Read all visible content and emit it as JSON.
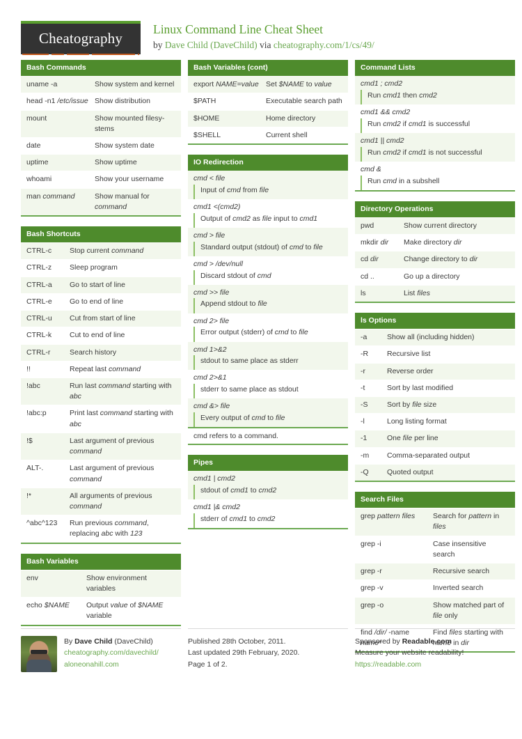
{
  "header": {
    "logo_text": "Cheatography",
    "title": "Linux Command Line Cheat Sheet",
    "byline_prefix": "by ",
    "author": "Dave Child (DaveChild)",
    "byline_via": " via ",
    "url": "cheatography.com/1/cs/49/"
  },
  "colors": {
    "brand_green": "#4e8b2c",
    "accent_green": "#6aa84f",
    "row_tint": "#f2f7ec",
    "logo_dark": "#333333",
    "logo_orange": "#c1571a"
  },
  "blocks": {
    "bash_commands": {
      "title": "Bash Commands",
      "rows": [
        {
          "k": "uname -a",
          "k_green": true,
          "v": "Show system and kernel"
        },
        {
          "k": "head -n1 /etc/issue",
          "k_green": true,
          "v": "Show distribution"
        },
        {
          "k": "mount",
          "k_green": true,
          "v": "Show mounted filesy­stems"
        },
        {
          "k": "date",
          "k_green": true,
          "v": "Show system date"
        },
        {
          "k": "uptime",
          "k_green": true,
          "v": "Show uptime"
        },
        {
          "k": "whoami",
          "k_green": true,
          "v": "Show your username"
        },
        {
          "k": "man command",
          "k_green": true,
          "v": "Show manual for command"
        }
      ]
    },
    "bash_shortcuts": {
      "title": "Bash Shortcuts",
      "rows": [
        {
          "k": "CTRL-c",
          "v": "Stop current command"
        },
        {
          "k": "CTRL-z",
          "v": "Sleep program"
        },
        {
          "k": "CTRL-a",
          "v": "Go to start of line"
        },
        {
          "k": "CTRL-e",
          "v": "Go to end of line"
        },
        {
          "k": "CTRL-u",
          "v": "Cut from start of line"
        },
        {
          "k": "CTRL-k",
          "v": "Cut to end of line"
        },
        {
          "k": "CTRL-r",
          "v": "Search history"
        },
        {
          "k": "!!",
          "v": "Repeat last command"
        },
        {
          "k": "!abc",
          "v": "Run last command starting with abc"
        },
        {
          "k": "!abc:p",
          "v": "Print last command starting with abc"
        },
        {
          "k": "!$",
          "v": "Last argument of previous command"
        },
        {
          "k": "ALT-.",
          "v": "Last argument of previous command"
        },
        {
          "k": "!*",
          "v": "All arguments of previous command"
        },
        {
          "k": "^abc^123",
          "v": "Run previous command, replacing abc with 123"
        }
      ]
    },
    "bash_variables": {
      "title": "Bash Variables",
      "rows": [
        {
          "k": "env",
          "v": "Show environment variables"
        },
        {
          "k": "echo $NAME",
          "k_green": true,
          "v": "Output value of $NAME variable"
        }
      ]
    },
    "bash_variables_cont": {
      "title": "Bash Variables (cont)",
      "rows": [
        {
          "k": "export NAME=value",
          "k_green": true,
          "v": "Set $NAME to value"
        },
        {
          "k": "$PATH",
          "v": "Executable search path"
        },
        {
          "k": "$HOME",
          "v": "Home directory"
        },
        {
          "k": "$SHELL",
          "v": "Current shell"
        }
      ]
    },
    "io_redirection": {
      "title": "IO Redirection",
      "rows": [
        {
          "code": "cmd < file",
          "desc": "Input of cmd from file"
        },
        {
          "code": "cmd1 <(cmd2)",
          "desc": "Output of cmd2 as file input to cmd1"
        },
        {
          "code": "cmd > file",
          "desc": "Standard output (stdout) of cmd to file"
        },
        {
          "code": "cmd > /dev/null",
          "desc": "Discard stdout of cmd"
        },
        {
          "code": "cmd >> file",
          "desc": "Append stdout to file"
        },
        {
          "code": "cmd 2> file",
          "desc": "Error output (stderr) of cmd to file"
        },
        {
          "code": "cmd 1>&2",
          "desc": "stdout to same place as stderr"
        },
        {
          "code": "cmd 2>&1",
          "desc": "stderr to same place as stdout"
        },
        {
          "code": "cmd &> file",
          "desc": "Every output of cmd to file"
        }
      ],
      "note": "cmd refers to a command."
    },
    "pipes": {
      "title": "Pipes",
      "rows": [
        {
          "code": "cmd1 | cmd2",
          "desc": "stdout of cmd1 to cmd2"
        },
        {
          "code": "cmd1 |& cmd2",
          "desc": "stderr of cmd1 to cmd2"
        }
      ]
    },
    "command_lists": {
      "title": "Command Lists",
      "rows": [
        {
          "code": "cmd1 ; cmd2",
          "desc": "Run cmd1 then cmd2"
        },
        {
          "code": "cmd1 && cmd2",
          "desc": "Run cmd2 if cmd1 is successful"
        },
        {
          "code": "cmd1 || cmd2",
          "desc": "Run cmd2 if cmd1 is not successful"
        },
        {
          "code": "cmd &",
          "desc": "Run cmd in a subshell"
        }
      ]
    },
    "directory_operations": {
      "title": "Directory Operations",
      "rows": [
        {
          "k": "pwd",
          "k_green": true,
          "v": "Show current directory"
        },
        {
          "k": "mkdir dir",
          "k_green": true,
          "v": "Make directory dir"
        },
        {
          "k": "cd dir",
          "k_green": true,
          "v": "Change directory to dir"
        },
        {
          "k": "cd ..",
          "v": "Go up a directory"
        },
        {
          "k": "ls",
          "k_green": true,
          "v": "List files"
        }
      ]
    },
    "ls_options": {
      "title": "ls Options",
      "rows": [
        {
          "k": "-a",
          "v": "Show all (including hidden)"
        },
        {
          "k": "-R",
          "v": "Recursive list"
        },
        {
          "k": "-r",
          "v": "Reverse order"
        },
        {
          "k": "-t",
          "v": "Sort by last modified"
        },
        {
          "k": "-S",
          "v": "Sort by file size"
        },
        {
          "k": "-l",
          "v": "Long listing format"
        },
        {
          "k": "-1",
          "v": "One file per line"
        },
        {
          "k": "-m",
          "v": "Comma-separated output"
        },
        {
          "k": "-Q",
          "v": "Quoted output"
        }
      ]
    },
    "search_files": {
      "title": "Search Files",
      "rows": [
        {
          "k": "grep pattern files",
          "k_green": true,
          "v": "Search for pattern in files"
        },
        {
          "k": "grep -i",
          "v": "Case insensitive search"
        },
        {
          "k": "grep -r",
          "v": "Recursive search"
        },
        {
          "k": "grep -v",
          "v": "Inverted search"
        },
        {
          "k": "grep -o",
          "v": "Show matched part of file only"
        },
        {
          "k": "find /dir/ -name name*",
          "k_green": true,
          "v": "Find files starting with name in dir"
        }
      ]
    }
  },
  "footer": {
    "author_prefix": "By ",
    "author_name": "Dave Child",
    "author_handle": " (DaveChild)",
    "author_url": "cheatography.com/davechild/",
    "author_site": "aloneonahill.com",
    "published": "Published 28th October, 2011.",
    "updated": "Last updated 29th February, 2020.",
    "page": "Page 1 of 2.",
    "sponsor_prefix": "Sponsored by ",
    "sponsor_name": "Readable.com",
    "sponsor_tagline": "Measure your website readability!",
    "sponsor_url": "https://readable.com"
  }
}
